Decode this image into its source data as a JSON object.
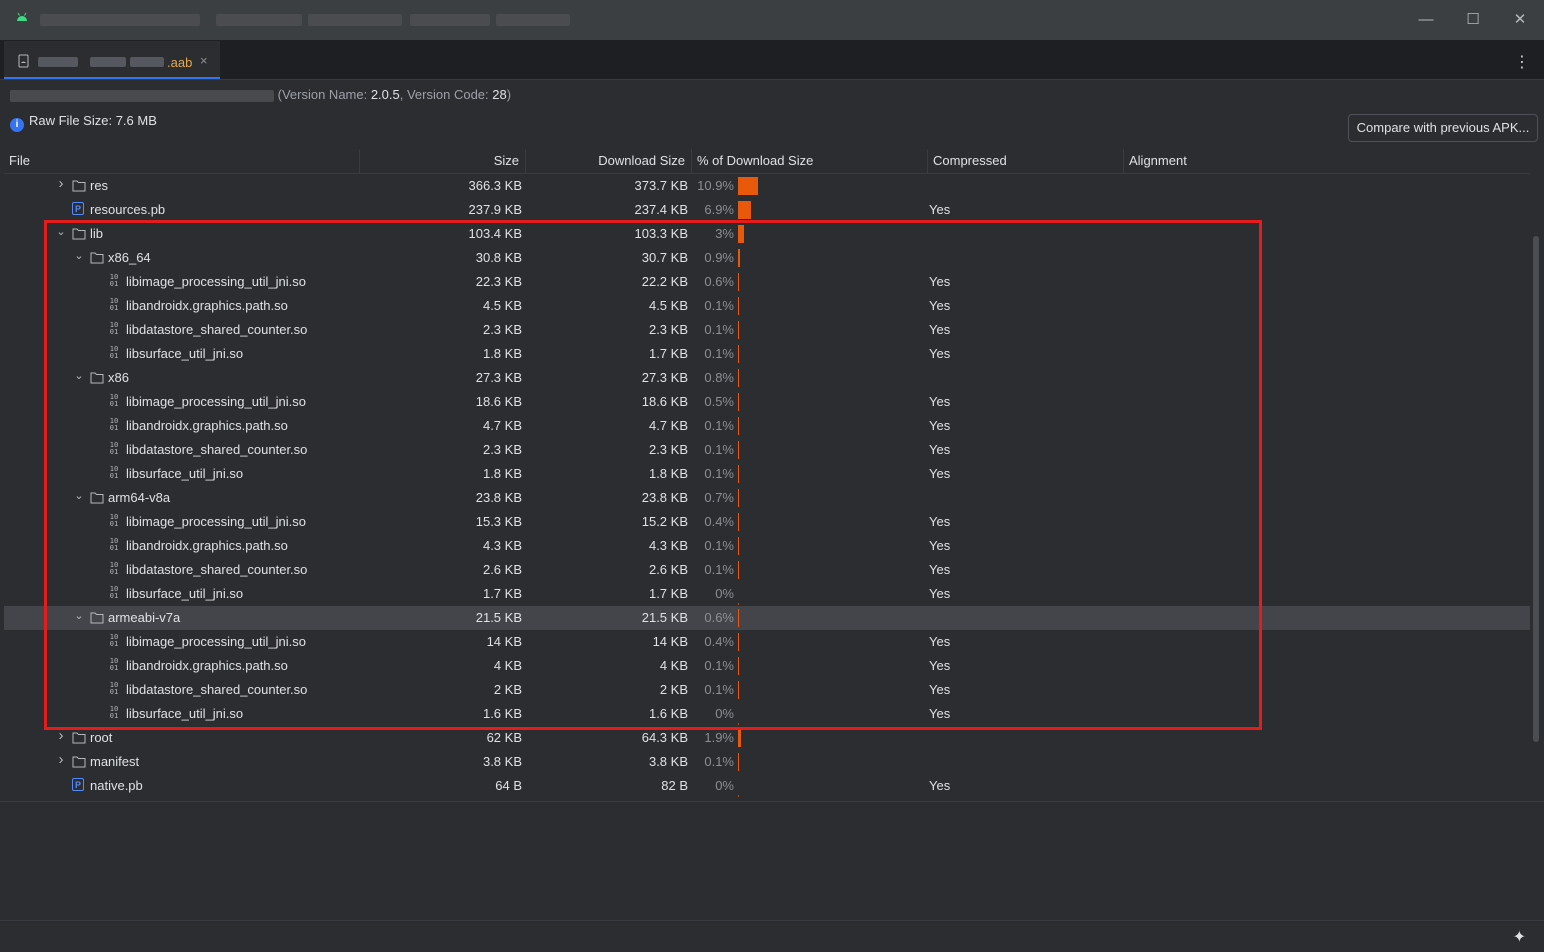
{
  "window": {
    "minimize": "—",
    "maximize": "☐",
    "close": "✕"
  },
  "tab": {
    "label": ".aab",
    "close": "×",
    "more": "⋮"
  },
  "info": {
    "prefix": "(Version Name: ",
    "version_name": "2.0.5",
    "mid": ", Version Code: ",
    "version_code": "28",
    "suffix": ")",
    "raw_label": "Raw File Size: ",
    "raw_size": "7.6 MB",
    "info_glyph": "i"
  },
  "compare_button": "Compare with previous APK...",
  "columns": {
    "file": "File",
    "size": "Size",
    "download": "Download Size",
    "percent": "% of Download Size",
    "compressed": "Compressed",
    "alignment": "Alignment"
  },
  "rows": [
    {
      "name": "res",
      "type": "folder",
      "expanded": false,
      "size": "366.3 KB",
      "download": "373.7 KB",
      "pct": "10.9%",
      "fraction": 0.109,
      "compressed": ""
    },
    {
      "name": "resources.pb",
      "type": "pb",
      "size": "237.9 KB",
      "download": "237.4 KB",
      "pct": "6.9%",
      "fraction": 0.069,
      "compressed": "Yes"
    },
    {
      "name": "lib",
      "type": "folder",
      "expanded": true,
      "size": "103.4 KB",
      "download": "103.3 KB",
      "pct": "3%",
      "fraction": 0.03,
      "compressed": ""
    },
    {
      "name": "x86_64",
      "type": "folder",
      "expanded": true,
      "size": "30.8 KB",
      "download": "30.7 KB",
      "pct": "0.9%",
      "fraction": 0.009,
      "compressed": ""
    },
    {
      "name": "libimage_processing_util_jni.so",
      "type": "so",
      "size": "22.3 KB",
      "download": "22.2 KB",
      "pct": "0.6%",
      "fraction": 0.006,
      "compressed": "Yes"
    },
    {
      "name": "libandroidx.graphics.path.so",
      "type": "so",
      "size": "4.5 KB",
      "download": "4.5 KB",
      "pct": "0.1%",
      "fraction": 0.001,
      "compressed": "Yes"
    },
    {
      "name": "libdatastore_shared_counter.so",
      "type": "so",
      "size": "2.3 KB",
      "download": "2.3 KB",
      "pct": "0.1%",
      "fraction": 0.001,
      "compressed": "Yes"
    },
    {
      "name": "libsurface_util_jni.so",
      "type": "so",
      "size": "1.8 KB",
      "download": "1.7 KB",
      "pct": "0.1%",
      "fraction": 0.001,
      "compressed": "Yes"
    },
    {
      "name": "x86",
      "type": "folder",
      "expanded": true,
      "size": "27.3 KB",
      "download": "27.3 KB",
      "pct": "0.8%",
      "fraction": 0.008,
      "compressed": ""
    },
    {
      "name": "libimage_processing_util_jni.so",
      "type": "so",
      "size": "18.6 KB",
      "download": "18.6 KB",
      "pct": "0.5%",
      "fraction": 0.005,
      "compressed": "Yes"
    },
    {
      "name": "libandroidx.graphics.path.so",
      "type": "so",
      "size": "4.7 KB",
      "download": "4.7 KB",
      "pct": "0.1%",
      "fraction": 0.001,
      "compressed": "Yes"
    },
    {
      "name": "libdatastore_shared_counter.so",
      "type": "so",
      "size": "2.3 KB",
      "download": "2.3 KB",
      "pct": "0.1%",
      "fraction": 0.001,
      "compressed": "Yes"
    },
    {
      "name": "libsurface_util_jni.so",
      "type": "so",
      "size": "1.8 KB",
      "download": "1.8 KB",
      "pct": "0.1%",
      "fraction": 0.001,
      "compressed": "Yes"
    },
    {
      "name": "arm64-v8a",
      "type": "folder",
      "expanded": true,
      "size": "23.8 KB",
      "download": "23.8 KB",
      "pct": "0.7%",
      "fraction": 0.007,
      "compressed": ""
    },
    {
      "name": "libimage_processing_util_jni.so",
      "type": "so",
      "size": "15.3 KB",
      "download": "15.2 KB",
      "pct": "0.4%",
      "fraction": 0.004,
      "compressed": "Yes"
    },
    {
      "name": "libandroidx.graphics.path.so",
      "type": "so",
      "size": "4.3 KB",
      "download": "4.3 KB",
      "pct": "0.1%",
      "fraction": 0.001,
      "compressed": "Yes"
    },
    {
      "name": "libdatastore_shared_counter.so",
      "type": "so",
      "size": "2.6 KB",
      "download": "2.6 KB",
      "pct": "0.1%",
      "fraction": 0.001,
      "compressed": "Yes"
    },
    {
      "name": "libsurface_util_jni.so",
      "type": "so",
      "size": "1.7 KB",
      "download": "1.7 KB",
      "pct": "0%",
      "fraction": 0.0,
      "compressed": "Yes"
    },
    {
      "name": "armeabi-v7a",
      "type": "folder",
      "expanded": true,
      "selected": true,
      "size": "21.5 KB",
      "download": "21.5 KB",
      "pct": "0.6%",
      "fraction": 0.006,
      "compressed": ""
    },
    {
      "name": "libimage_processing_util_jni.so",
      "type": "so",
      "size": "14 KB",
      "download": "14 KB",
      "pct": "0.4%",
      "fraction": 0.004,
      "compressed": "Yes"
    },
    {
      "name": "libandroidx.graphics.path.so",
      "type": "so",
      "size": "4 KB",
      "download": "4 KB",
      "pct": "0.1%",
      "fraction": 0.001,
      "compressed": "Yes"
    },
    {
      "name": "libdatastore_shared_counter.so",
      "type": "so",
      "size": "2 KB",
      "download": "2 KB",
      "pct": "0.1%",
      "fraction": 0.001,
      "compressed": "Yes"
    },
    {
      "name": "libsurface_util_jni.so",
      "type": "so",
      "size": "1.6 KB",
      "download": "1.6 KB",
      "pct": "0%",
      "fraction": 0.0,
      "compressed": "Yes"
    },
    {
      "name": "root",
      "type": "folder",
      "expanded": false,
      "size": "62 KB",
      "download": "64.3 KB",
      "pct": "1.9%",
      "fraction": 0.019,
      "compressed": ""
    },
    {
      "name": "manifest",
      "type": "folder",
      "expanded": false,
      "size": "3.8 KB",
      "download": "3.8 KB",
      "pct": "0.1%",
      "fraction": 0.001,
      "compressed": ""
    },
    {
      "name": "native.pb",
      "type": "pb",
      "size": "64 B",
      "download": "82 B",
      "pct": "0%",
      "fraction": 0.0,
      "compressed": "Yes"
    }
  ],
  "colors": {
    "bar": "#e8590c",
    "highlight": "#e51c1c",
    "selection": "#43454a"
  }
}
